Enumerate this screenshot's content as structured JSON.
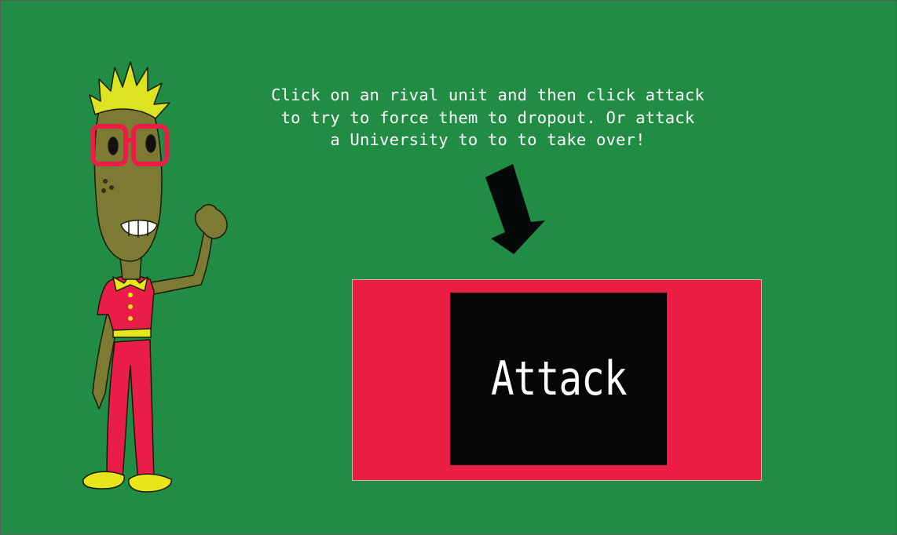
{
  "colors": {
    "background": "#218c44",
    "panel": "#ec1e45",
    "button": "#070506",
    "arrow": "#060909",
    "text": "#ffffff",
    "mascot_skin": "#7d7a34",
    "mascot_hair": "#dce320",
    "mascot_clothes": "#ea1d48",
    "mascot_accent": "#e6e61a"
  },
  "tutorial": {
    "lines": [
      "Click on an rival unit and then click attack",
      "to try to force them to dropout. Or attack",
      "a University to to to take over!"
    ]
  },
  "attack_button": {
    "label": "Attack"
  },
  "icons": {
    "arrow": "down-arrow-icon",
    "mascot": "nerd-mascot"
  }
}
